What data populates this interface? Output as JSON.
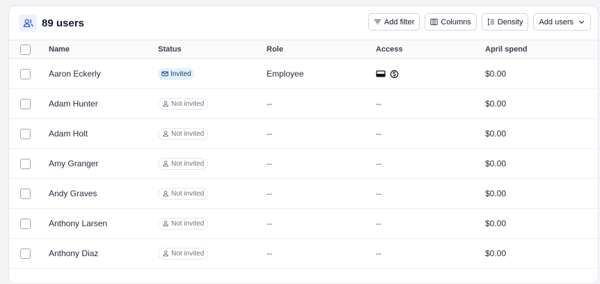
{
  "header": {
    "title": "89 users",
    "buttons": {
      "add_filter": "Add filter",
      "columns": "Columns",
      "density": "Density",
      "add_users": "Add users"
    }
  },
  "table": {
    "columns": {
      "name": "Name",
      "status": "Status",
      "role": "Role",
      "access": "Access",
      "spend": "April spend"
    },
    "rows": [
      {
        "name": "Aaron Eckerly",
        "status": "Invited",
        "role": "Employee",
        "access": "",
        "spend": "$0.00"
      },
      {
        "name": "Adam Hunter",
        "status": "Not invited",
        "role": "--",
        "access": "--",
        "spend": "$0.00"
      },
      {
        "name": "Adam Holt",
        "status": "Not invited",
        "role": "--",
        "access": "--",
        "spend": "$0.00"
      },
      {
        "name": "Amy Granger",
        "status": "Not invited",
        "role": "--",
        "access": "--",
        "spend": "$0.00"
      },
      {
        "name": "Andy Graves",
        "status": "Not invited",
        "role": "--",
        "access": "--",
        "spend": "$0.00"
      },
      {
        "name": "Anthony Larsen",
        "status": "Not invited",
        "role": "--",
        "access": "--",
        "spend": "$0.00"
      },
      {
        "name": "Anthony Diaz",
        "status": "Not invited",
        "role": "--",
        "access": "--",
        "spend": "$0.00"
      }
    ]
  },
  "icons": {
    "title": "users-icon",
    "add_filter": "filter-icon",
    "columns": "columns-icon",
    "density": "density-icon",
    "add_users": "chevron-down-icon",
    "invited": "mail-icon",
    "not_invited": "user-icon",
    "access": [
      "card-icon",
      "dollar-circle-icon"
    ]
  },
  "colors": {
    "accent": "#3b5bdb",
    "invited_badge_bg": "#e0f2fe"
  }
}
